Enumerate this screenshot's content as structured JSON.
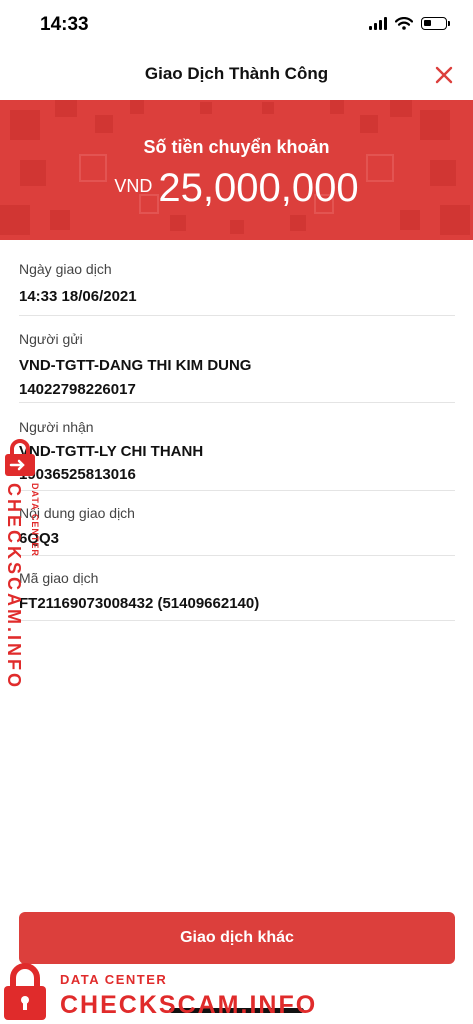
{
  "status_bar": {
    "time": "14:33",
    "battery_level": 0.3
  },
  "header": {
    "title": "Giao Dịch Thành Công",
    "close_icon": "close-icon"
  },
  "banner": {
    "label": "Số tiền chuyển khoản",
    "currency": "VND",
    "amount": "25,000,000",
    "background": "#dc3f3c"
  },
  "details": {
    "date": {
      "label": "Ngày giao dịch",
      "value": "14:33 18/06/2021"
    },
    "sender": {
      "label": "Người gửi",
      "name": "VND-TGTT-DANG THI KIM DUNG",
      "account": "14022798226017"
    },
    "receiver": {
      "label": "Người nhận",
      "name": "VND-TGTT-LY CHI THANH",
      "account": "19036525813016"
    },
    "content": {
      "label": "Nội dung giao dịch",
      "value": "6QQ3"
    },
    "code": {
      "label": "Mã giao dịch",
      "value": "FT21169073008432 (51409662140)"
    }
  },
  "button": {
    "label": "Giao dịch khác"
  },
  "watermark": {
    "sub": "DATA CENTER",
    "main": "CHECKSCAM.INFO",
    "color": "#e02b2b"
  }
}
